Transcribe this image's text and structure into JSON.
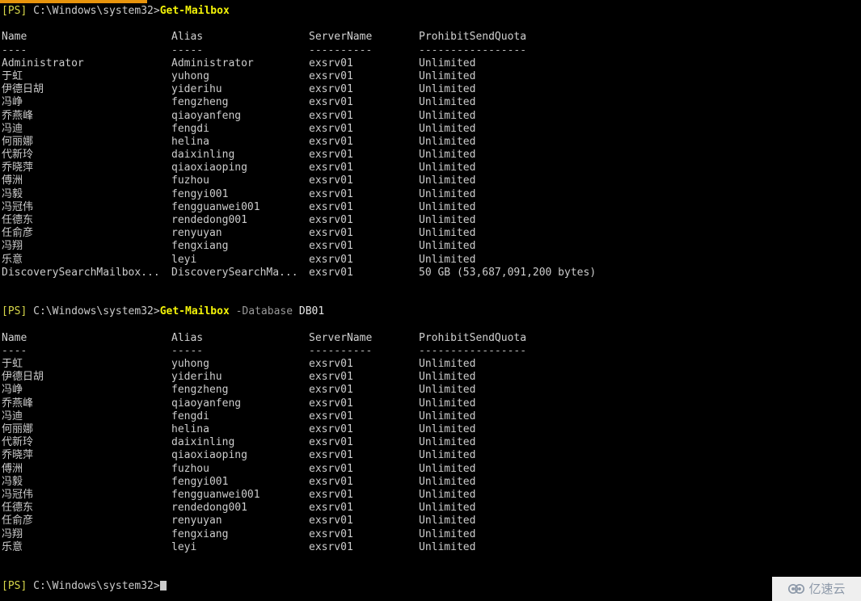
{
  "terminal": {
    "title_strip_color": "#e8940c",
    "background": "#000000",
    "foreground": "#cccccc",
    "prompt_bracket": "[PS]",
    "prompt_path": " C:\\Windows\\system32>",
    "cursor": "block"
  },
  "columns": {
    "name": "Name",
    "alias": "Alias",
    "server": "ServerName",
    "quota": "ProhibitSendQuota",
    "rule_name": "----",
    "rule_alias": "-----",
    "rule_server": "----------",
    "rule_quota": "-----------------"
  },
  "commands": {
    "first": {
      "cmdlet": "Get-Mailbox",
      "param": "",
      "value": ""
    },
    "second": {
      "cmdlet": "Get-Mailbox",
      "param": " -Database",
      "value": " DB01"
    }
  },
  "block1": {
    "rows": [
      {
        "name": "Administrator",
        "alias": "Administrator",
        "server": "exsrv01",
        "quota": "Unlimited"
      },
      {
        "name": "于虹",
        "alias": "yuhong",
        "server": "exsrv01",
        "quota": "Unlimited"
      },
      {
        "name": "伊德日胡",
        "alias": "yiderihu",
        "server": "exsrv01",
        "quota": "Unlimited"
      },
      {
        "name": "冯峥",
        "alias": "fengzheng",
        "server": "exsrv01",
        "quota": "Unlimited"
      },
      {
        "name": "乔燕峰",
        "alias": "qiaoyanfeng",
        "server": "exsrv01",
        "quota": "Unlimited"
      },
      {
        "name": "冯迪",
        "alias": "fengdi",
        "server": "exsrv01",
        "quota": "Unlimited"
      },
      {
        "name": "何丽娜",
        "alias": "helina",
        "server": "exsrv01",
        "quota": "Unlimited"
      },
      {
        "name": "代新玲",
        "alias": "daixinling",
        "server": "exsrv01",
        "quota": "Unlimited"
      },
      {
        "name": "乔晓萍",
        "alias": "qiaoxiaoping",
        "server": "exsrv01",
        "quota": "Unlimited"
      },
      {
        "name": "傅洲",
        "alias": "fuzhou",
        "server": "exsrv01",
        "quota": "Unlimited"
      },
      {
        "name": "冯毅",
        "alias": "fengyi001",
        "server": "exsrv01",
        "quota": "Unlimited"
      },
      {
        "name": "冯冠伟",
        "alias": "fengguanwei001",
        "server": "exsrv01",
        "quota": "Unlimited"
      },
      {
        "name": "任德东",
        "alias": "rendedong001",
        "server": "exsrv01",
        "quota": "Unlimited"
      },
      {
        "name": "任俞彦",
        "alias": "renyuyan",
        "server": "exsrv01",
        "quota": "Unlimited"
      },
      {
        "name": "冯翔",
        "alias": "fengxiang",
        "server": "exsrv01",
        "quota": "Unlimited"
      },
      {
        "name": "乐意",
        "alias": "leyi",
        "server": "exsrv01",
        "quota": "Unlimited"
      },
      {
        "name": "DiscoverySearchMailbox...",
        "alias": "DiscoverySearchMa...",
        "server": "exsrv01",
        "quota": "50 GB (53,687,091,200 bytes)"
      }
    ]
  },
  "block2": {
    "rows": [
      {
        "name": "于虹",
        "alias": "yuhong",
        "server": "exsrv01",
        "quota": "Unlimited"
      },
      {
        "name": "伊德日胡",
        "alias": "yiderihu",
        "server": "exsrv01",
        "quota": "Unlimited"
      },
      {
        "name": "冯峥",
        "alias": "fengzheng",
        "server": "exsrv01",
        "quota": "Unlimited"
      },
      {
        "name": "乔燕峰",
        "alias": "qiaoyanfeng",
        "server": "exsrv01",
        "quota": "Unlimited"
      },
      {
        "name": "冯迪",
        "alias": "fengdi",
        "server": "exsrv01",
        "quota": "Unlimited"
      },
      {
        "name": "何丽娜",
        "alias": "helina",
        "server": "exsrv01",
        "quota": "Unlimited"
      },
      {
        "name": "代新玲",
        "alias": "daixinling",
        "server": "exsrv01",
        "quota": "Unlimited"
      },
      {
        "name": "乔晓萍",
        "alias": "qiaoxiaoping",
        "server": "exsrv01",
        "quota": "Unlimited"
      },
      {
        "name": "傅洲",
        "alias": "fuzhou",
        "server": "exsrv01",
        "quota": "Unlimited"
      },
      {
        "name": "冯毅",
        "alias": "fengyi001",
        "server": "exsrv01",
        "quota": "Unlimited"
      },
      {
        "name": "冯冠伟",
        "alias": "fengguanwei001",
        "server": "exsrv01",
        "quota": "Unlimited"
      },
      {
        "name": "任德东",
        "alias": "rendedong001",
        "server": "exsrv01",
        "quota": "Unlimited"
      },
      {
        "name": "任俞彦",
        "alias": "renyuyan",
        "server": "exsrv01",
        "quota": "Unlimited"
      },
      {
        "name": "冯翔",
        "alias": "fengxiang",
        "server": "exsrv01",
        "quota": "Unlimited"
      },
      {
        "name": "乐意",
        "alias": "leyi",
        "server": "exsrv01",
        "quota": "Unlimited"
      }
    ]
  },
  "watermark": {
    "text": "亿速云",
    "icon": "cloud-logo-icon",
    "background": "#efefef",
    "color": "#8c98a8"
  }
}
